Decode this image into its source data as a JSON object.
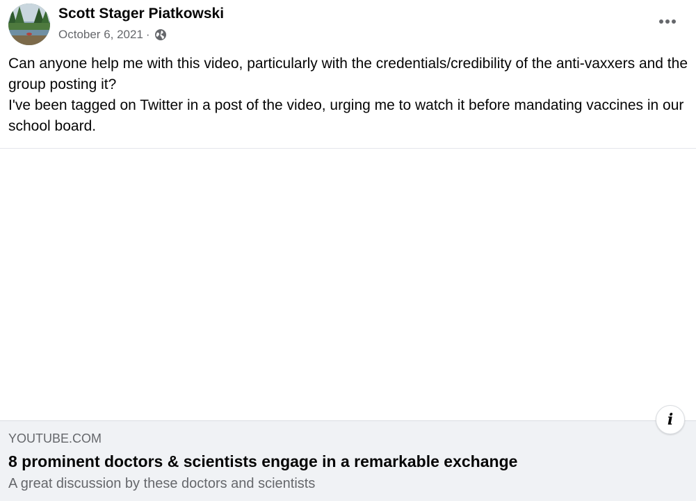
{
  "post": {
    "author": "Scott Stager Piatkowski",
    "date": "October 6, 2021",
    "separator": "·",
    "audience_icon": "globe-icon",
    "more_icon": "more-options-icon",
    "message": [
      "Can anyone help me with this video, particularly with the credentials/credibility of the anti-vaxxers and the group posting it?",
      "I've been tagged on Twitter in a post of the video, urging me to watch it before mandating vaccines in our school board."
    ]
  },
  "link": {
    "domain": "YOUTUBE.COM",
    "title": "8 prominent doctors & scientists engage in a remarkable exchange",
    "description": "A great discussion by these doctors and scientists",
    "info_icon": "info-icon",
    "info_label": "i"
  },
  "colors": {
    "text_primary": "#050505",
    "text_secondary": "#65676b",
    "card_background": "#f0f2f5",
    "divider": "#e4e6eb"
  }
}
